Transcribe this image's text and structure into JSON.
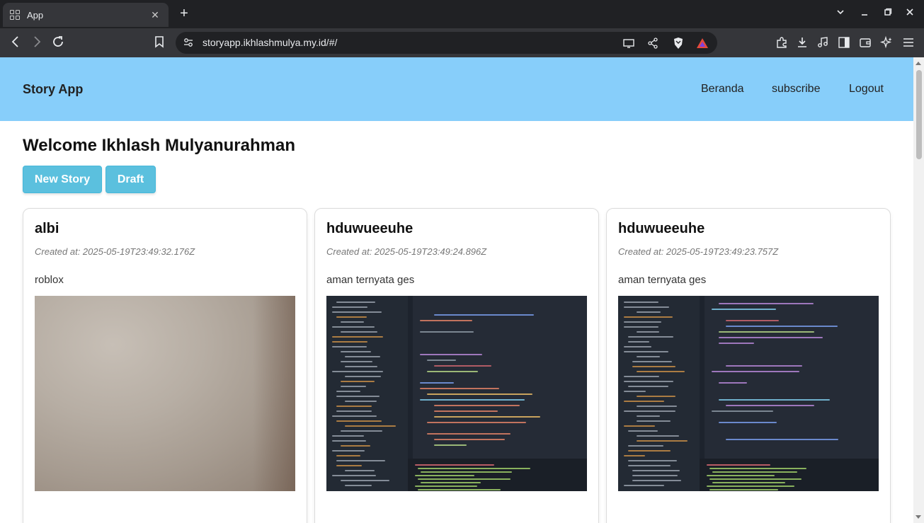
{
  "browser": {
    "tab_title": "App",
    "tab_close": "✕",
    "new_tab": "+",
    "url": "storyapp.ikhlashmulya.my.id/#/"
  },
  "site": {
    "brand": "Story App",
    "nav": [
      "Beranda",
      "subscribe",
      "Logout"
    ]
  },
  "main": {
    "welcome": "Welcome Ikhlash Mulyanurahman",
    "new_story_label": "New Story",
    "draft_label": "Draft"
  },
  "stories": [
    {
      "title": "albi",
      "created": "Created at: 2025-05-19T23:49:32.176Z",
      "description": "roblox",
      "image": "photo-wall"
    },
    {
      "title": "hduwueeuhe",
      "created": "Created at: 2025-05-19T23:49:24.896Z",
      "description": "aman ternyata ges",
      "image": "photo-code-editor"
    },
    {
      "title": "hduwueeuhe",
      "created": "Created at: 2025-05-19T23:49:23.757Z",
      "description": "aman ternyata ges",
      "image": "photo-code-editor"
    }
  ],
  "colors": {
    "header_bg": "#87cefa",
    "button_bg": "#5bc0de"
  }
}
